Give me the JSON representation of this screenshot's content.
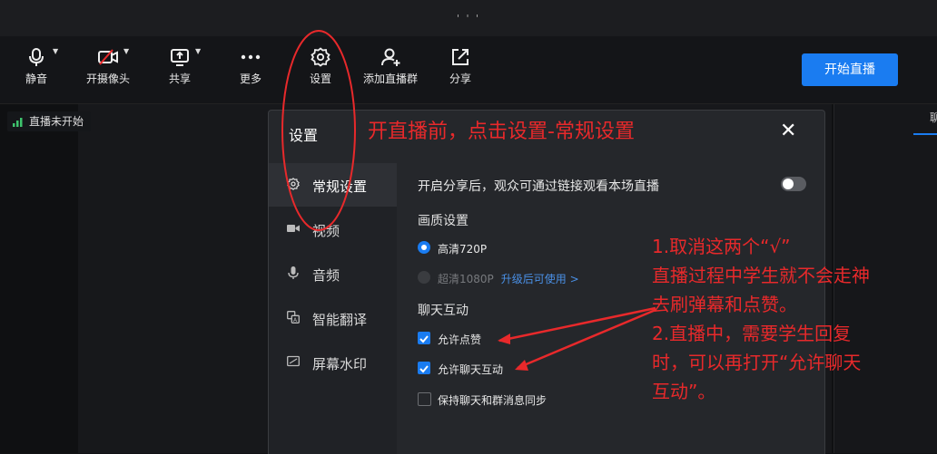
{
  "window": {
    "title_dots": "' ' '"
  },
  "toolbar": {
    "mute": "静音",
    "camera": "开摄像头",
    "share_screen": "共享",
    "more": "更多",
    "settings": "设置",
    "add_group": "添加直播群",
    "share": "分享",
    "start_live": "开始直播"
  },
  "status": {
    "text": "直播未开始"
  },
  "right_panel": {
    "tab": "聊"
  },
  "dialog": {
    "title": "设置",
    "close": "✕",
    "nav": [
      {
        "label": "常规设置",
        "icon": "gear-icon",
        "active": true
      },
      {
        "label": "视频",
        "icon": "camera-icon",
        "active": false
      },
      {
        "label": "音频",
        "icon": "mic-icon",
        "active": false
      },
      {
        "label": "智能翻译",
        "icon": "translate-icon",
        "active": false
      },
      {
        "label": "屏幕水印",
        "icon": "watermark-icon",
        "active": false
      }
    ],
    "share_option": {
      "label": "开启分享后，观众可通过链接观看本场直播",
      "enabled": false
    },
    "quality": {
      "heading": "画质设置",
      "options": [
        {
          "label": "高清720P",
          "selected": true,
          "disabled": false
        },
        {
          "label": "超清1080P",
          "selected": false,
          "disabled": true,
          "note": "升级后可使用 >"
        }
      ]
    },
    "chat": {
      "heading": "聊天互动",
      "options": [
        {
          "label": "允许点赞",
          "checked": true
        },
        {
          "label": "允许聊天互动",
          "checked": true
        },
        {
          "label": "保持聊天和群消息同步",
          "checked": false
        }
      ]
    }
  },
  "annotations": {
    "top": "开直播前，点击设置-常规设置",
    "lines": [
      "1.取消这两个“√”",
      "直播过程中学生就不会走神",
      "去刷弹幕和点赞。",
      "2.直播中，需要学生回复",
      "时，可以再打开“允许聊天",
      "互动”。"
    ]
  },
  "colors": {
    "accent": "#1a7cf1",
    "annotation": "#e8292b"
  }
}
